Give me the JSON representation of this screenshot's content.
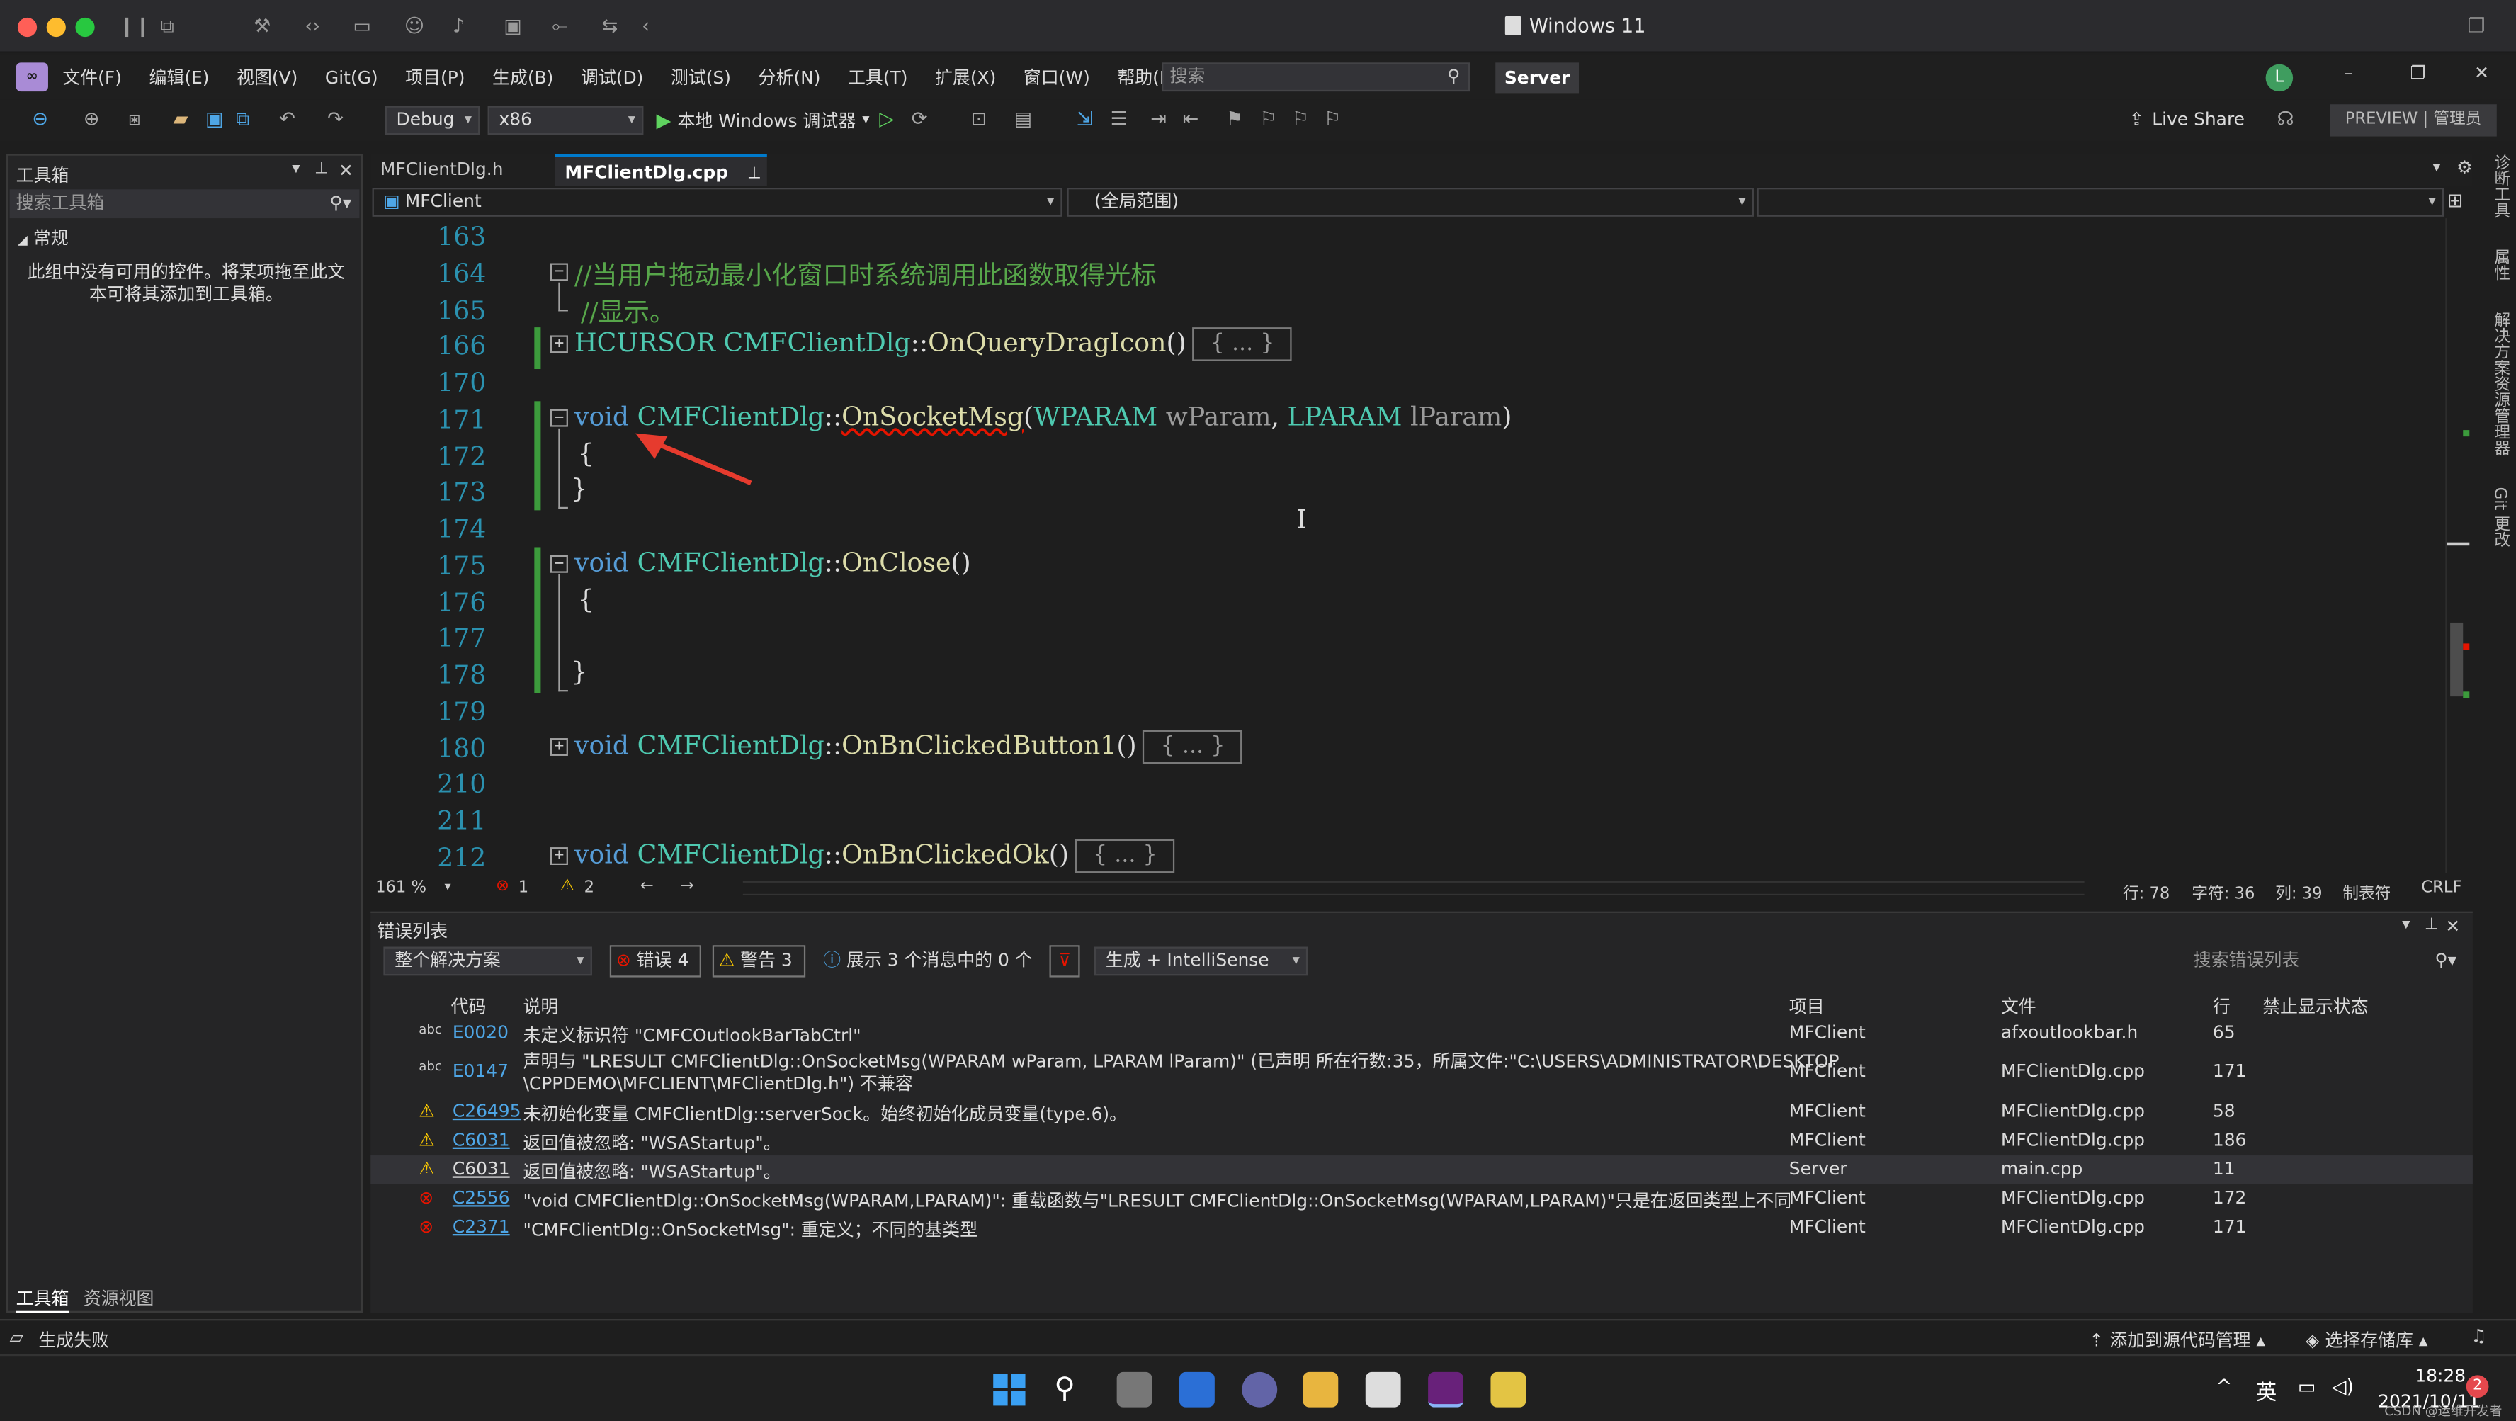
{
  "window_title": "Windows 11",
  "menu": [
    "文件(F)",
    "编辑(E)",
    "视图(V)",
    "Git(G)",
    "项目(P)",
    "生成(B)",
    "调试(D)",
    "测试(S)",
    "分析(N)",
    "工具(T)",
    "扩展(X)",
    "窗口(W)",
    "帮助(H)"
  ],
  "search_placeholder": "搜索",
  "project_badge": "Server",
  "user_initial": "L",
  "toolbar": {
    "config": "Debug",
    "platform": "x86",
    "run_label": "本地 Windows 调试器",
    "live_share": "Live Share",
    "preview": "PREVIEW | 管理员"
  },
  "toolbox": {
    "title": "工具箱",
    "search": "搜索工具箱",
    "section": "常规",
    "empty_text": "此组中没有可用的控件。将某项拖至此文本可将其添加到工具箱。",
    "tab1": "工具箱",
    "tab2": "资源视图"
  },
  "right_rail": [
    "诊断工具",
    "属性",
    "解决方案资源管理器",
    "Git 更改"
  ],
  "tabs": [
    {
      "label": "MFClientDlg.h"
    },
    {
      "label": "MFClientDlg.cpp"
    }
  ],
  "nav": {
    "class": "MFClient",
    "scope": "(全局范围)"
  },
  "lines": {
    "l163": "163",
    "l164": "164",
    "l165": "165",
    "l166": "166",
    "l170": "170",
    "l171": "171",
    "l172": "172",
    "l173": "173",
    "l174": "174",
    "l175": "175",
    "l176": "176",
    "l177": "177",
    "l178": "178",
    "l179": "179",
    "l180": "180",
    "l210": "210",
    "l211": "211",
    "l212": "212"
  },
  "code": {
    "c164": "//当用户拖动最小化窗口时系统调用此函数取得光标",
    "c165": "//显示。",
    "c166_type": "HCURSOR",
    "c166_cls": "CMFClientDlg",
    "c166_fn": "OnQueryDragIcon",
    "collapsed": "{ ... }",
    "void": "void",
    "cls": "CMFClientDlg",
    "sep": "::",
    "c171_fn": "OnSocketMsg",
    "c171_t1": "WPARAM",
    "c171_p1": "wParam",
    "c171_t2": "LPARAM",
    "c171_p2": "lParam",
    "open": "{",
    "close": "}",
    "c175_fn": "OnClose",
    "c180_fn": "OnBnClickedButton1",
    "c212_fn": "OnBnClickedOk",
    "parens": "()"
  },
  "editor_status": {
    "zoom": "161 %",
    "errors": "1",
    "warnings": "2",
    "line": "行: 78",
    "char": "字符: 36",
    "col": "列: 39",
    "tabs": "制表符",
    "eol": "CRLF"
  },
  "error_list": {
    "title": "错误列表",
    "scope": "整个解决方案",
    "errors_btn": "错误 4",
    "warnings_btn": "警告 3",
    "messages_btn": "展示 3 个消息中的 0 个",
    "source": "生成 + IntelliSense",
    "search": "搜索错误列表",
    "headers": {
      "code": "代码",
      "desc": "说明",
      "project": "项目",
      "file": "文件",
      "line": "行",
      "suppress": "禁止显示状态"
    },
    "rows": [
      {
        "code": "E0020",
        "desc": "未定义标识符 \"CMFCOutlookBarTabCtrl\"",
        "project": "MFClient",
        "file": "afxoutlookbar.h",
        "line": "65"
      },
      {
        "code": "E0147",
        "desc": "声明与 \"LRESULT CMFClientDlg::OnSocketMsg(WPARAM wParam, LPARAM lParam)\" (已声明 所在行数:35，所属文件:\"C:\\USERS\\ADMINISTRATOR\\DESKTOP",
        "desc2": "\\CPPDEMO\\MFCLIENT\\MFClientDlg.h\") 不兼容",
        "project": "MFClient",
        "file": "MFClientDlg.cpp",
        "line": "171"
      },
      {
        "code": "C26495",
        "desc": "未初始化变量 CMFClientDlg::serverSock。始终初始化成员变量(type.6)。",
        "project": "MFClient",
        "file": "MFClientDlg.cpp",
        "line": "58"
      },
      {
        "code": "C6031",
        "desc": "返回值被忽略: \"WSAStartup\"。",
        "project": "MFClient",
        "file": "MFClientDlg.cpp",
        "line": "186"
      },
      {
        "code": "C6031",
        "desc": "返回值被忽略: \"WSAStartup\"。",
        "project": "Server",
        "file": "main.cpp",
        "line": "11"
      },
      {
        "code": "C2556",
        "desc": "\"void CMFClientDlg::OnSocketMsg(WPARAM,LPARAM)\": 重载函数与\"LRESULT CMFClientDlg::OnSocketMsg(WPARAM,LPARAM)\"只是在返回类型上不同",
        "project": "MFClient",
        "file": "MFClientDlg.cpp",
        "line": "172"
      },
      {
        "code": "C2371",
        "desc": "\"CMFClientDlg::OnSocketMsg\": 重定义；不同的基类型",
        "project": "MFClient",
        "file": "MFClientDlg.cpp",
        "line": "171"
      }
    ]
  },
  "status": {
    "build": "生成失败",
    "add_source": "添加到源代码管理",
    "repo": "选择存储库"
  },
  "taskbar": {
    "lang": "英",
    "time": "18:28",
    "date": "2021/10/11",
    "notif": "2",
    "watermark": "CSDN @运维开发者"
  },
  "colors": {
    "accent": "#007acc",
    "error": "#e51400",
    "warning": "#ffcc00",
    "vs_purple": "#68217a"
  }
}
